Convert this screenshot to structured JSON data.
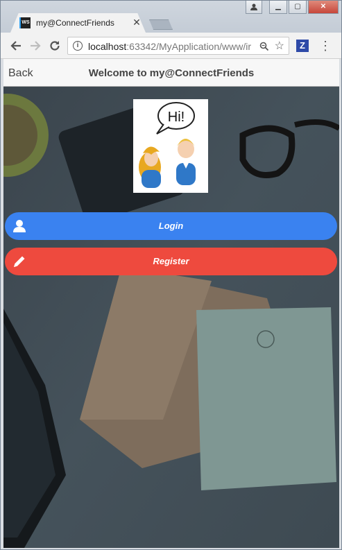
{
  "browser": {
    "tab_title": "my@ConnectFriends",
    "tab_favicon_text": "WS",
    "url_host": "localhost",
    "url_rest": ":63342/MyApplication/www/ir",
    "extension_letter": "Z"
  },
  "app": {
    "back_label": "Back",
    "title": "Welcome to my@ConnectFriends",
    "logo_speech": "Hi!",
    "login_label": "Login",
    "register_label": "Register",
    "login_color": "#3a82f0",
    "register_color": "#ee4a3e"
  },
  "icons": {
    "login": "user-icon",
    "register": "pencil-icon"
  }
}
